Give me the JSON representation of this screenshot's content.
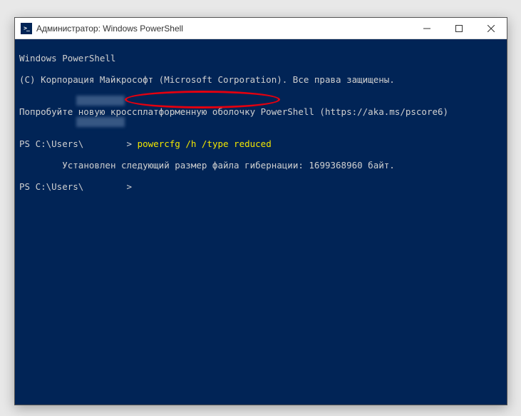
{
  "window": {
    "title": "Администратор: Windows PowerShell"
  },
  "terminal": {
    "line1": "Windows PowerShell",
    "line2": "(C) Корпорация Майкрософт (Microsoft Corporation). Все права защищены.",
    "line3": "",
    "line4": "Попробуйте новую кроссплатформенную оболочку PowerShell (https://aka.ms/pscore6)",
    "line5": "",
    "prompt1_prefix": "PS C:\\Users\\",
    "prompt1_user_hidden": "        ",
    "prompt1_gt": "> ",
    "command": "powercfg /h /type reduced",
    "result_indent": "        ",
    "result": "Установлен следующий размер файла гибернации: 1699368960 байт.",
    "prompt2_prefix": "PS C:\\Users\\",
    "prompt2_user_hidden": "        ",
    "prompt2_gt": ">"
  }
}
